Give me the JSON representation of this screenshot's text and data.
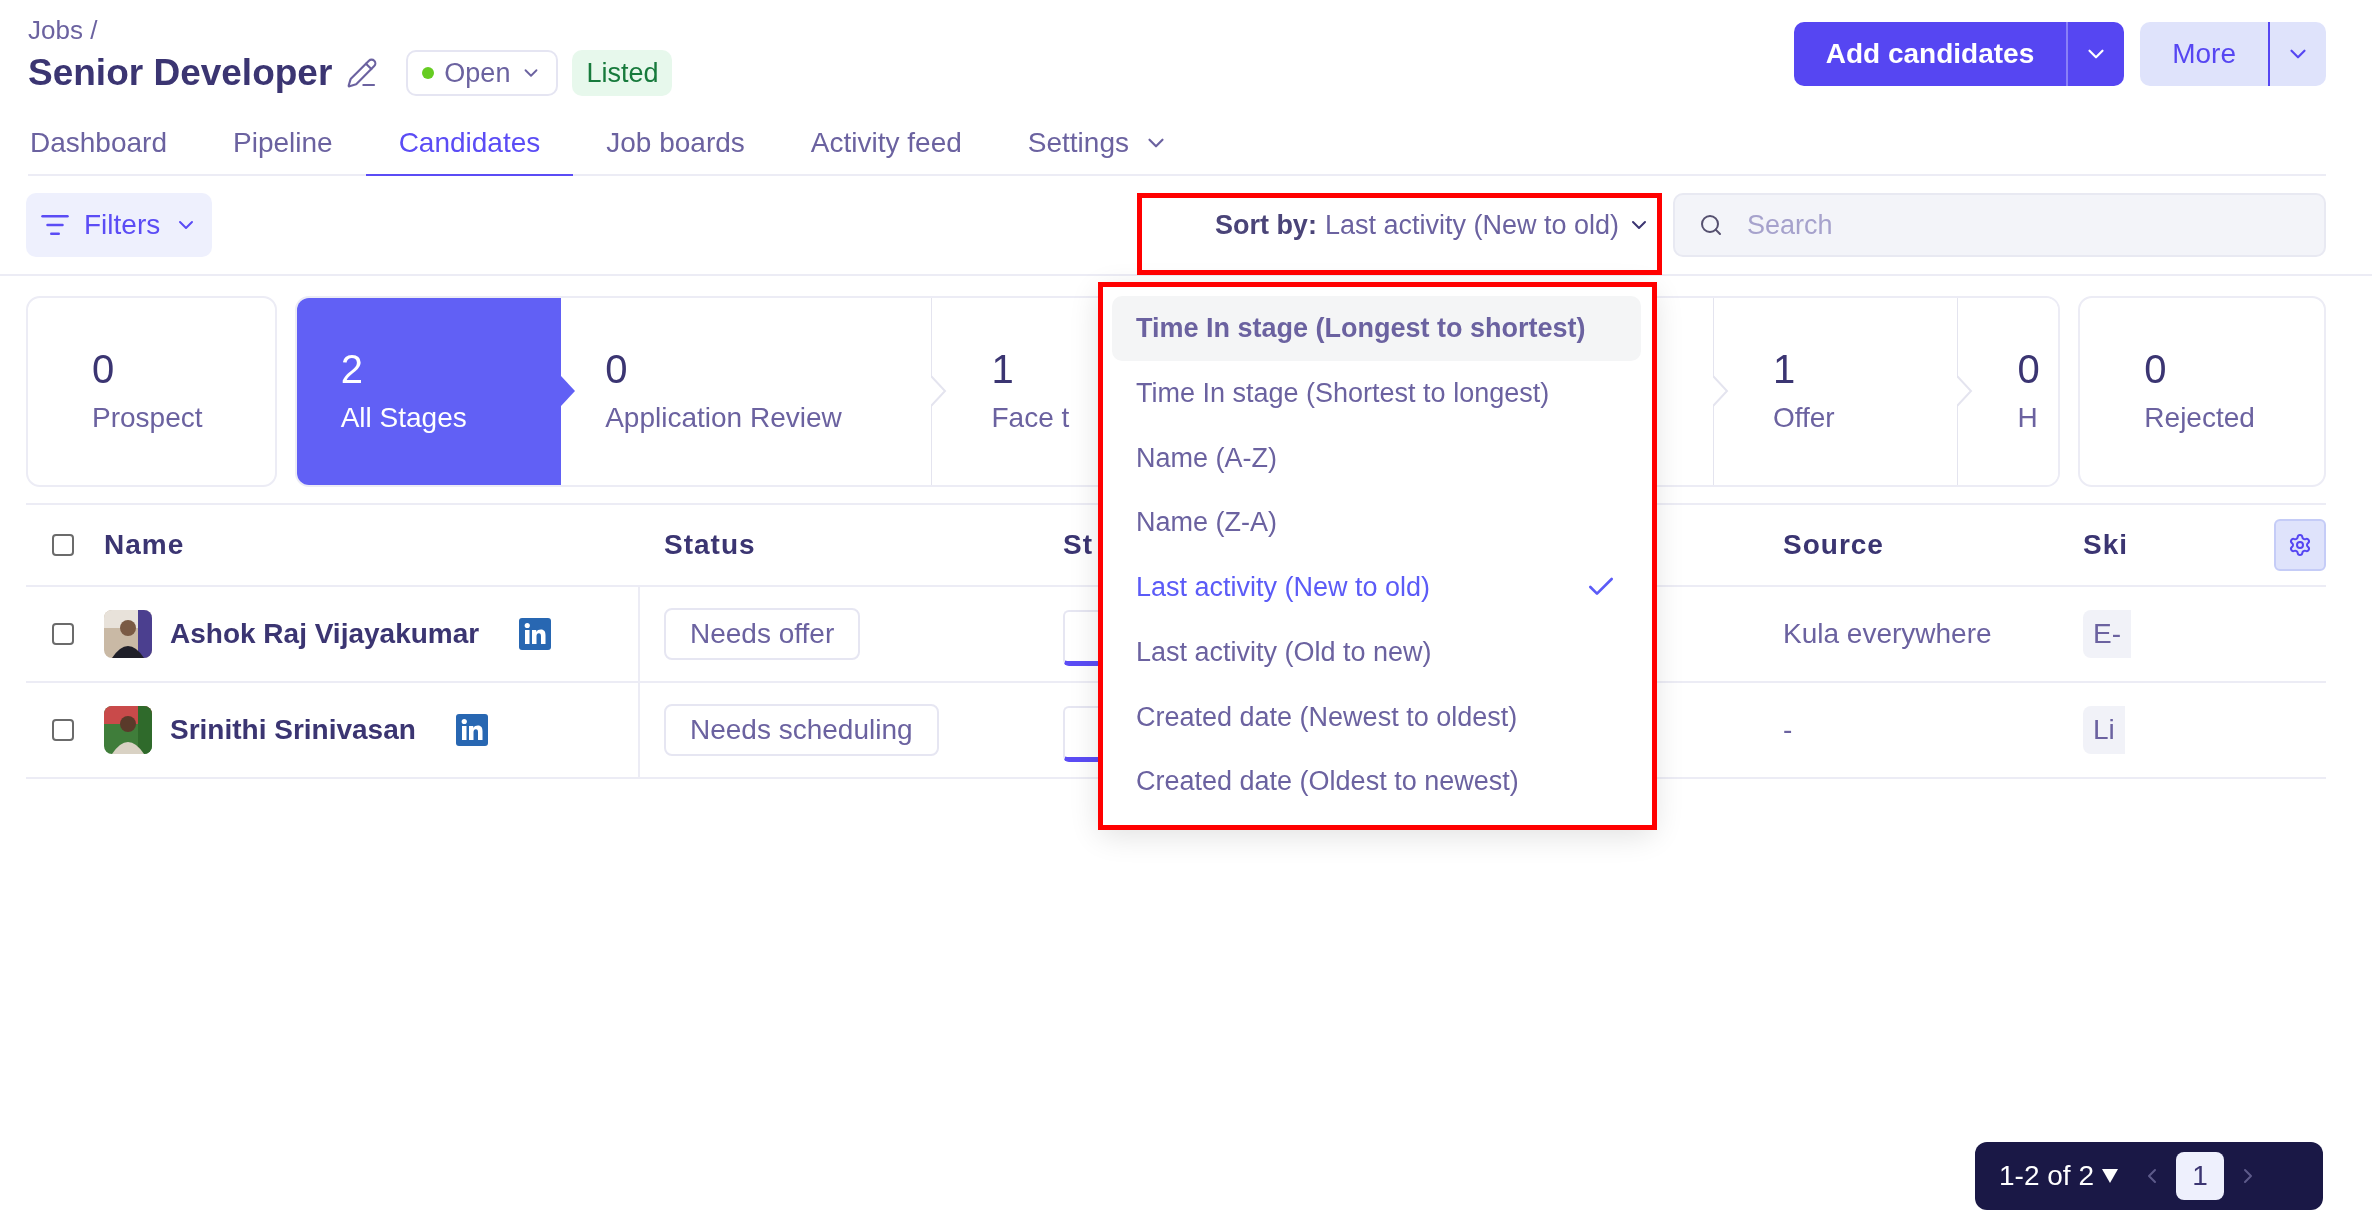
{
  "breadcrumb": "Jobs /",
  "title": "Senior Developer",
  "status_menu": {
    "label": "Open",
    "color": "#66cc22"
  },
  "badge": "Listed",
  "actions": [
    {
      "label": "Add candidates",
      "kind": "primary"
    },
    {
      "label": "More",
      "kind": "secondary"
    }
  ],
  "tabs": [
    {
      "label": "Dashboard",
      "selected": false,
      "kind": "link"
    },
    {
      "label": "Pipeline",
      "selected": false,
      "kind": "link"
    },
    {
      "label": "Candidates",
      "selected": true,
      "kind": "link"
    },
    {
      "label": "Job boards",
      "selected": false,
      "kind": "link"
    },
    {
      "label": "Activity feed",
      "selected": false,
      "kind": "link"
    },
    {
      "label": "Settings",
      "selected": false,
      "kind": "menu"
    }
  ],
  "filters_button": "Filters",
  "sort": {
    "prefix": "Sort by:",
    "value": "Last activity (New to old)"
  },
  "search": {
    "placeholder": "Search"
  },
  "stages": [
    {
      "count": "0",
      "label": "Prospect",
      "kind": "card",
      "selected": false
    },
    {
      "count": "2",
      "label": "All Stages",
      "kind": "step",
      "selected": true
    },
    {
      "count": "0",
      "label": "Application Review",
      "kind": "step",
      "selected": false
    },
    {
      "count": "1",
      "label": "Face t",
      "kind": "step",
      "selected": false
    },
    {
      "count": "1",
      "label": "Offer",
      "kind": "step",
      "selected": false
    },
    {
      "count": "0",
      "label": "H",
      "kind": "step",
      "selected": false
    },
    {
      "count": "0",
      "label": "Rejected",
      "kind": "card",
      "selected": false
    }
  ],
  "table": {
    "columns": [
      "Name",
      "Status",
      "St",
      "Source",
      "Ski"
    ],
    "all_checked": false,
    "rows": [
      {
        "name": "Ashok Raj Vijayakumar",
        "checked": false,
        "status": "Needs offer",
        "source": "Kula everywhere",
        "skill": "E-"
      },
      {
        "name": "Srinithi Srinivasan",
        "checked": false,
        "status": "Needs scheduling",
        "source": "-",
        "skill": "Li"
      }
    ]
  },
  "sort_menu": [
    {
      "label": "Time In stage (Longest to shortest)",
      "focused": true,
      "selected": false
    },
    {
      "label": "Time In stage (Shortest to longest)",
      "focused": false,
      "selected": false
    },
    {
      "label": "Name (A-Z)",
      "focused": false,
      "selected": false
    },
    {
      "label": "Name (Z-A)",
      "focused": false,
      "selected": false
    },
    {
      "label": "Last activity (New to old)",
      "focused": false,
      "selected": true
    },
    {
      "label": "Last activity (Old to new)",
      "focused": false,
      "selected": false
    },
    {
      "label": "Created date (Newest to oldest)",
      "focused": false,
      "selected": false
    },
    {
      "label": "Created date (Oldest to newest)",
      "focused": false,
      "selected": false
    }
  ],
  "pagination": {
    "range": "1-2 of 2",
    "pages": [
      {
        "label": "1",
        "selected": true
      }
    ]
  }
}
